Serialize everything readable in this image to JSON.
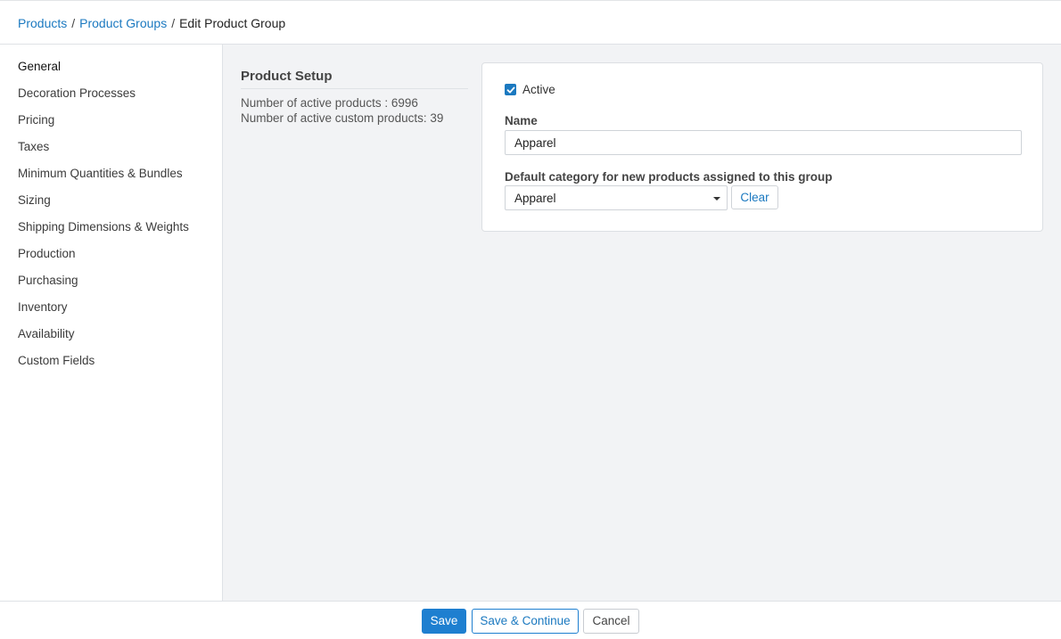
{
  "breadcrumb": {
    "items": [
      {
        "label": "Products"
      },
      {
        "label": "Product Groups"
      }
    ],
    "separator": "/",
    "current": "Edit Product Group"
  },
  "sidebar": {
    "items": [
      {
        "label": "General",
        "active": true
      },
      {
        "label": "Decoration Processes"
      },
      {
        "label": "Pricing"
      },
      {
        "label": "Taxes"
      },
      {
        "label": "Minimum Quantities & Bundles"
      },
      {
        "label": "Sizing"
      },
      {
        "label": "Shipping Dimensions & Weights"
      },
      {
        "label": "Production"
      },
      {
        "label": "Purchasing"
      },
      {
        "label": "Inventory"
      },
      {
        "label": "Availability"
      },
      {
        "label": "Custom Fields"
      }
    ]
  },
  "setup": {
    "title": "Product Setup",
    "active_products": "Number of active products : 6996",
    "active_custom_products": "Number of active custom products: 39"
  },
  "form": {
    "active_label": "Active",
    "active_checked": true,
    "name_label": "Name",
    "name_value": "Apparel",
    "category_label": "Default category for new products assigned to this group",
    "category_value": "Apparel",
    "clear_label": "Clear"
  },
  "footer": {
    "save_label": "Save",
    "save_continue_label": "Save & Continue",
    "cancel_label": "Cancel"
  },
  "colors": {
    "accent": "#1e7fd0",
    "link": "#1b79c0",
    "content_bg": "#f2f3f5"
  },
  "icons": {
    "checkbox": "checkmark-icon",
    "select": "caret-down-icon"
  }
}
